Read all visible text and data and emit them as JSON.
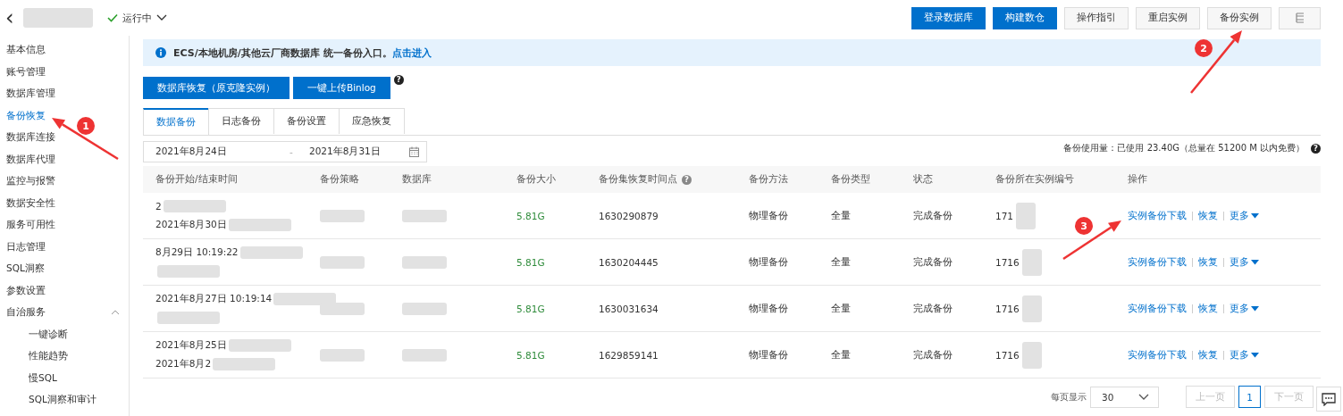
{
  "header": {
    "back": "‹",
    "status": "运行中",
    "buttons": [
      {
        "label": "登录数据库",
        "primary": true
      },
      {
        "label": "构建数仓",
        "primary": true
      },
      {
        "label": "操作指引",
        "primary": false
      },
      {
        "label": "重启实例",
        "primary": false
      },
      {
        "label": "备份实例",
        "primary": false
      }
    ]
  },
  "sidebar": {
    "items": [
      {
        "label": "基本信息",
        "selected": false
      },
      {
        "label": "账号管理",
        "selected": false
      },
      {
        "label": "数据库管理",
        "selected": false
      },
      {
        "label": "备份恢复",
        "selected": true
      },
      {
        "label": "数据库连接",
        "selected": false
      },
      {
        "label": "数据库代理",
        "selected": false
      },
      {
        "label": "监控与报警",
        "selected": false
      },
      {
        "label": "数据安全性",
        "selected": false
      },
      {
        "label": "服务可用性",
        "selected": false
      },
      {
        "label": "日志管理",
        "selected": false
      },
      {
        "label": "SQL洞察",
        "selected": false
      },
      {
        "label": "参数设置",
        "selected": false
      },
      {
        "label": "自治服务",
        "selected": false,
        "expanded": true,
        "children": [
          {
            "label": "一键诊断",
            "selected": false
          },
          {
            "label": "性能趋势",
            "selected": false
          },
          {
            "label": "慢SQL",
            "selected": false
          },
          {
            "label": "SQL洞察和审计",
            "selected": false
          }
        ]
      }
    ]
  },
  "notice": {
    "text": "ECS/本地机房/其他云厂商数据库 统一备份入口。",
    "link": "点击进入"
  },
  "actions": [
    {
      "label": "数据库恢复（原克隆实例）"
    },
    {
      "label": "一键上传Binlog",
      "help": "?"
    }
  ],
  "tabs": [
    {
      "label": "数据备份",
      "selected": true
    },
    {
      "label": "日志备份",
      "selected": false
    },
    {
      "label": "备份设置",
      "selected": false
    },
    {
      "label": "应急恢复",
      "selected": false
    }
  ],
  "date_range": {
    "start": "2021年8月24日",
    "separator": "-",
    "end": "2021年8月31日"
  },
  "usage": "备份使用量：已使用 23.40G（总量在 51200 M 以内免费）",
  "usage_help": "?",
  "table": {
    "columns": [
      {
        "label": "备份开始/结束时间"
      },
      {
        "label": "备份策略"
      },
      {
        "label": "数据库"
      },
      {
        "label": "备份大小"
      },
      {
        "label": "备份集恢复时间点",
        "help": "?"
      },
      {
        "label": "备份方法"
      },
      {
        "label": "备份类型"
      },
      {
        "label": "状态"
      },
      {
        "label": "备份所在实例编号"
      },
      {
        "label": "操作"
      }
    ],
    "rows": [
      {
        "time": [
          "2",
          "2021年8月30日"
        ],
        "size": "5.81G",
        "point": "1630290879",
        "method": "物理备份",
        "type": "全量",
        "status": "完成备份",
        "instance": "171",
        "actions": [
          "实例备份下载",
          "恢复",
          "更多"
        ]
      },
      {
        "time": [
          "8月29日 10:19:22"
        ],
        "size": "5.81G",
        "point": "1630204445",
        "method": "物理备份",
        "type": "全量",
        "status": "完成备份",
        "instance": "1716",
        "actions": [
          "实例备份下载",
          "恢复",
          "更多"
        ]
      },
      {
        "time": [
          "2021年8月27日 10:19:14"
        ],
        "size": "5.81G",
        "point": "1630031634",
        "method": "物理备份",
        "type": "全量",
        "status": "完成备份",
        "instance": "1716",
        "actions": [
          "实例备份下载",
          "恢复",
          "更多"
        ]
      },
      {
        "time": [
          "2021年8月25日",
          "2021年8月2"
        ],
        "size": "5.81G",
        "point": "1629859141",
        "method": "物理备份",
        "type": "全量",
        "status": "完成备份",
        "instance": "1716",
        "actions": [
          "实例备份下载",
          "恢复",
          "更多"
        ]
      }
    ]
  },
  "pagination": {
    "page_size_label": "每页显示",
    "page_size": "30",
    "prev": "上一页",
    "pages": [
      {
        "label": "1",
        "selected": true
      }
    ],
    "next": "下一页"
  },
  "annotations": [
    {
      "label": "1"
    },
    {
      "label": "2"
    },
    {
      "label": "3"
    }
  ]
}
